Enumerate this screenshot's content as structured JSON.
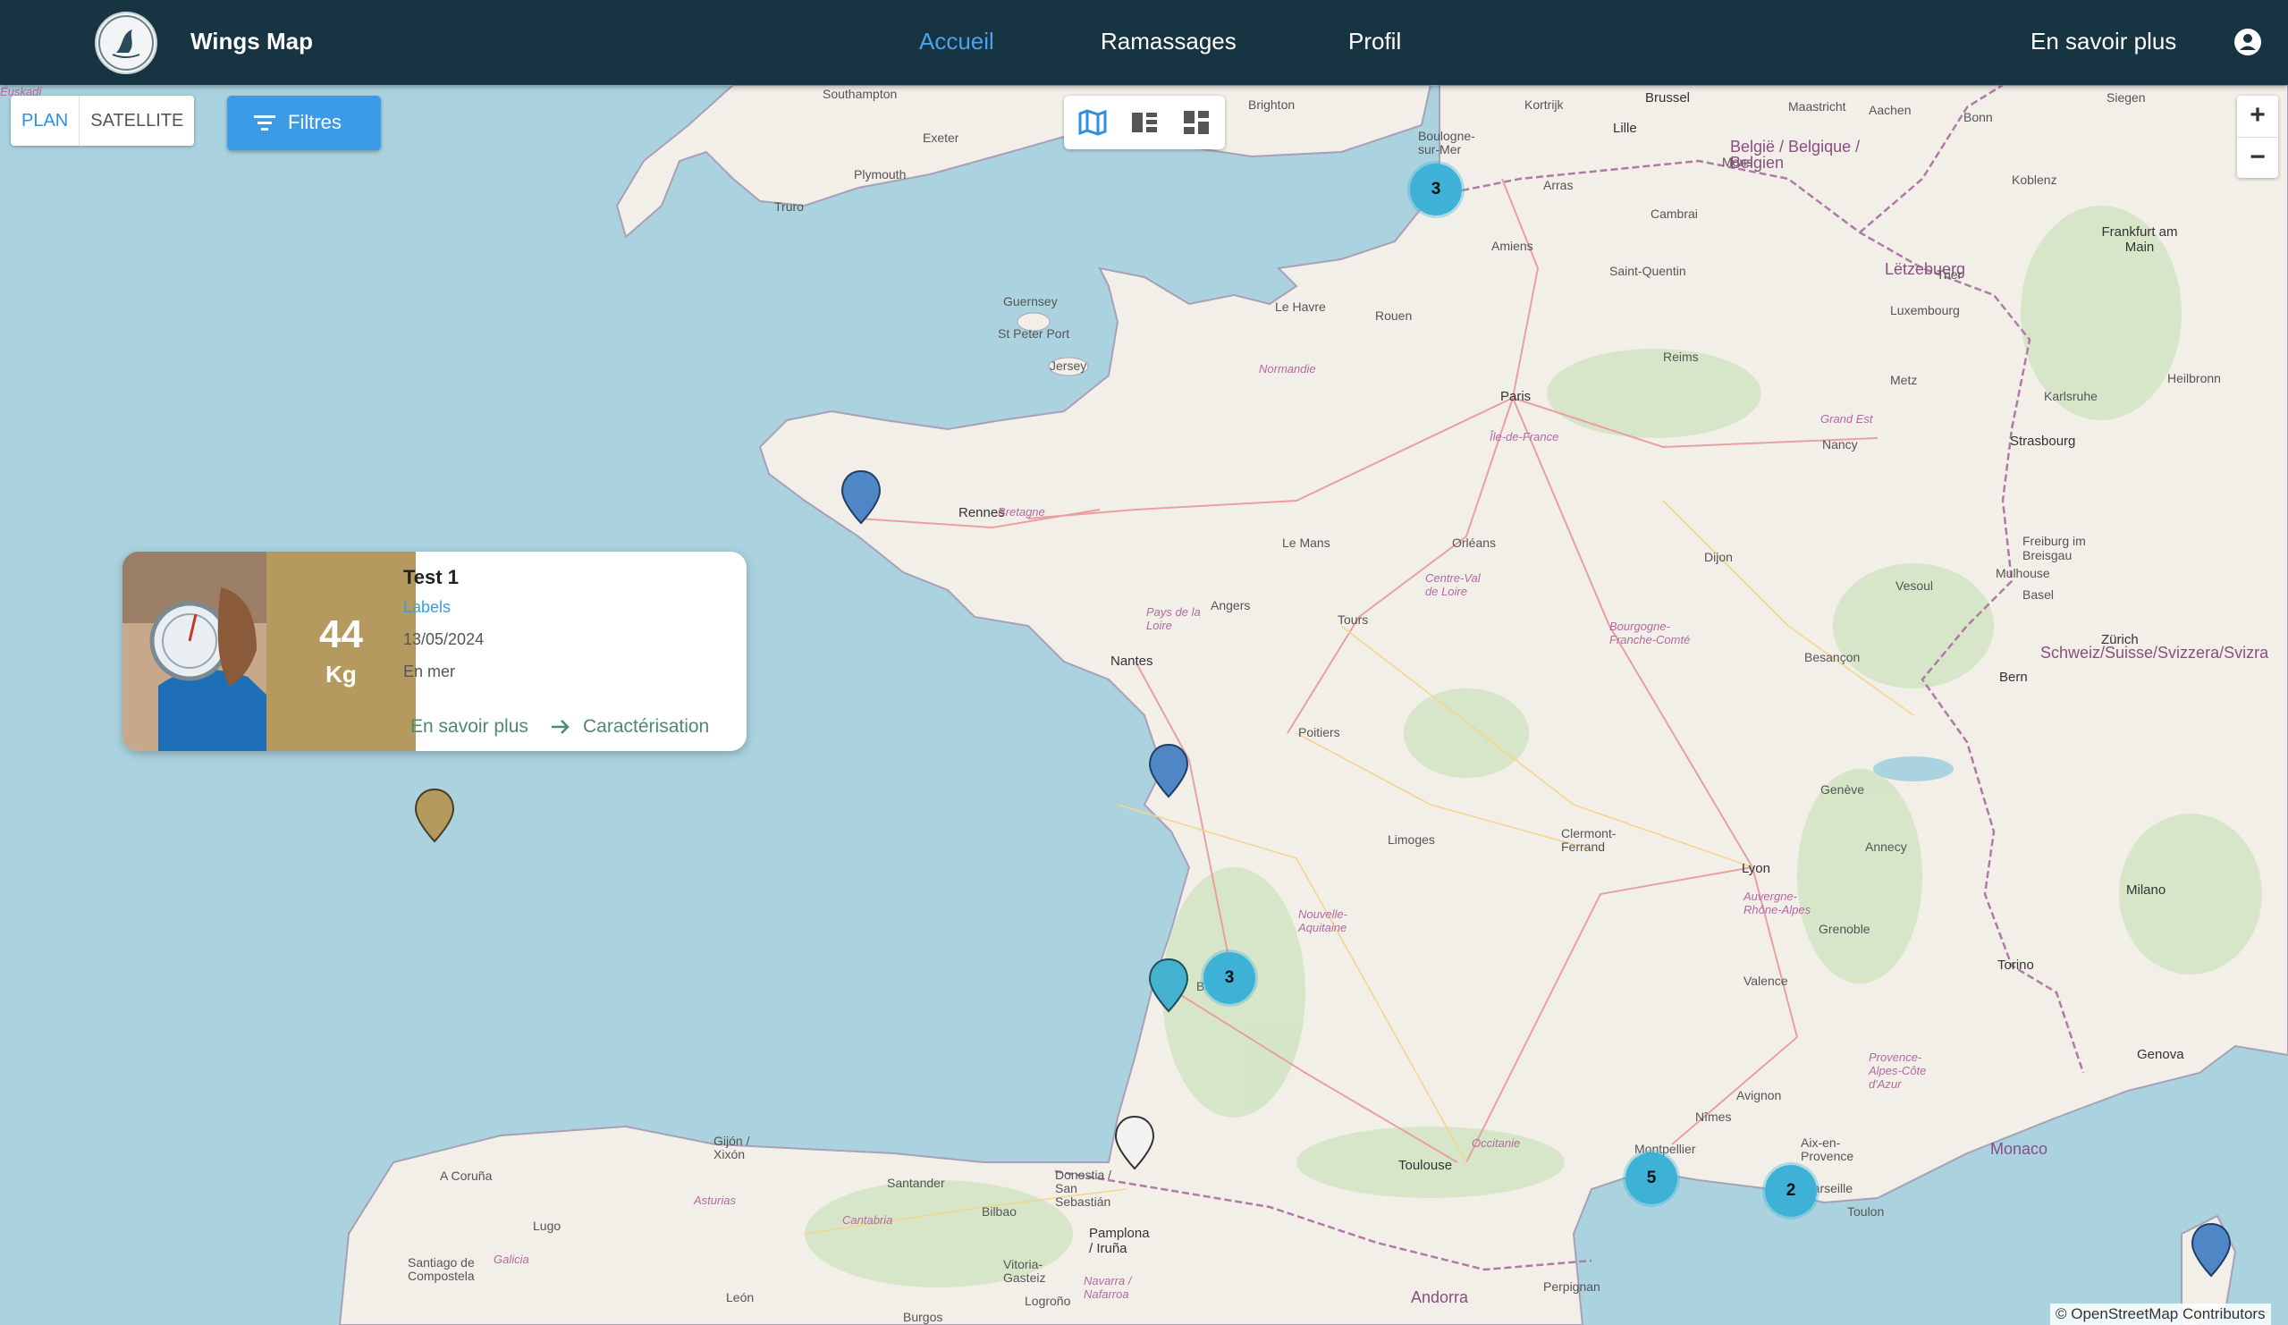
{
  "header": {
    "title": "Wings Map",
    "nav": [
      {
        "label": "Accueil",
        "active": true
      },
      {
        "label": "Ramassages"
      },
      {
        "label": "Profil"
      }
    ],
    "learn_more": "En savoir plus",
    "icons": {
      "logo": "wings-of-the-ocean-logo",
      "user": "account-circle-icon"
    }
  },
  "controls": {
    "layers": [
      "PLAN",
      "SATELLITE"
    ],
    "active_layer": "PLAN",
    "filter_label": "Filtres",
    "view_icons": [
      "map-view-icon",
      "split-view-icon",
      "grid-view-icon"
    ],
    "zoom_in": "+",
    "zoom_out": "−"
  },
  "clusters": [
    "3",
    "3",
    "5",
    "2"
  ],
  "popup": {
    "weight": "44",
    "unit": "Kg",
    "title": "Test 1",
    "labels": "Labels",
    "date": "13/05/2024",
    "location": "En mer",
    "more": "En savoir plus",
    "characterization": "Caractérisation"
  },
  "places": {
    "southampton": "Southampton",
    "brighton": "Brighton",
    "exeter": "Exeter",
    "plymouth": "Plymouth",
    "truro": "Truro",
    "bruxelles": "Brussel",
    "kortrijk": "Kortrijk",
    "maastricht": "Maastricht",
    "aachen": "Aachen",
    "bonn": "Bonn",
    "siegen": "Siegen",
    "boulogne": "Boulogne-sur-Mer",
    "lille": "Lille",
    "mons": "Mons",
    "belgique": "België / Belgique / Belgien",
    "arras": "Arras",
    "cambrai": "Cambrai",
    "amiens": "Amiens",
    "saintquentin": "Saint-Quentin",
    "frankfurt": "Frankfurt am Main",
    "koblenz": "Koblenz",
    "luxembourg": "Lëtzebuerg",
    "luxembourg2": "Luxembourg",
    "trier": "Trier",
    "guernsey": "Guernsey",
    "stpeter": "St Peter Port",
    "jersey": "Jersey",
    "lehavre": "Le Havre",
    "rouen": "Rouen",
    "normandie": "Normandie",
    "reims": "Reims",
    "metz": "Metz",
    "paris": "Paris",
    "iledefrance": "Île-de-France",
    "grandest": "Grand Est",
    "nancy": "Nancy",
    "strasbourg": "Strasbourg",
    "karlsruhe": "Karlsruhe",
    "heilbronn": "Heilbronn",
    "rennes": "Rennes",
    "bretagne": "Bretagne",
    "lemans": "Le Mans",
    "orleans": "Orléans",
    "angers": "Angers",
    "tours": "Tours",
    "centre": "Centre-Val de Loire",
    "paysdeloire": "Pays de la Loire",
    "nantes": "Nantes",
    "poitiers": "Poitiers",
    "bourgogne": "Bourgogne-Franche-Comté",
    "besancon": "Besançon",
    "dijon": "Dijon",
    "mulhouse": "Mulhouse",
    "vesoul": "Vesoul",
    "freiburg": "Freiburg im Breisgau",
    "basel": "Basel",
    "zurich": "Zürich",
    "bern": "Bern",
    "schweiz": "Schweiz/Suisse/Svizzera/Svizra",
    "limoges": "Limoges",
    "clermont": "Clermont-Ferrand",
    "lyon": "Lyon",
    "auvergne": "Auvergne-Rhône-Alpes",
    "geneve": "Genève",
    "annecy": "Annecy",
    "grenoble": "Grenoble",
    "torino": "Torino",
    "milano": "Milano",
    "valence": "Valence",
    "nouvelleaquitaine": "Nouvelle-Aquitaine",
    "bordeaux": "Bordeaux",
    "toulouse": "Toulouse",
    "occitanie": "Occitanie",
    "montpellier": "Montpellier",
    "nimes": "Nîmes",
    "avignon": "Avignon",
    "aix": "Aix-en-Provence",
    "marseille": "Marseille",
    "toulon": "Toulon",
    "monaco": "Monaco",
    "genova": "Genova",
    "paca": "Provence-Alpes-Côte d'Azur",
    "gijon": "Gijón / Xixón",
    "acoruna": "A Coruña",
    "lugo": "Lugo",
    "santiago": "Santiago de Compostela",
    "asturias": "Asturias",
    "cantabria": "Cantabria",
    "santander": "Santander",
    "bilbao": "Bilbao",
    "donostia": "Donostia / San Sebastián",
    "pamplona": "Pamplona / Iruña",
    "vitoria": "Vitoria-Gasteiz",
    "euskadi": "Euskadi",
    "navarra": "Navarra / Nafarroa",
    "logrono": "Logroño",
    "burgos": "Burgos",
    "leon": "León",
    "andorra": "Andorra",
    "perpignan": "Perpignan",
    "galicia": "Galicia"
  },
  "attribution": "© OpenStreetMap Contributors"
}
